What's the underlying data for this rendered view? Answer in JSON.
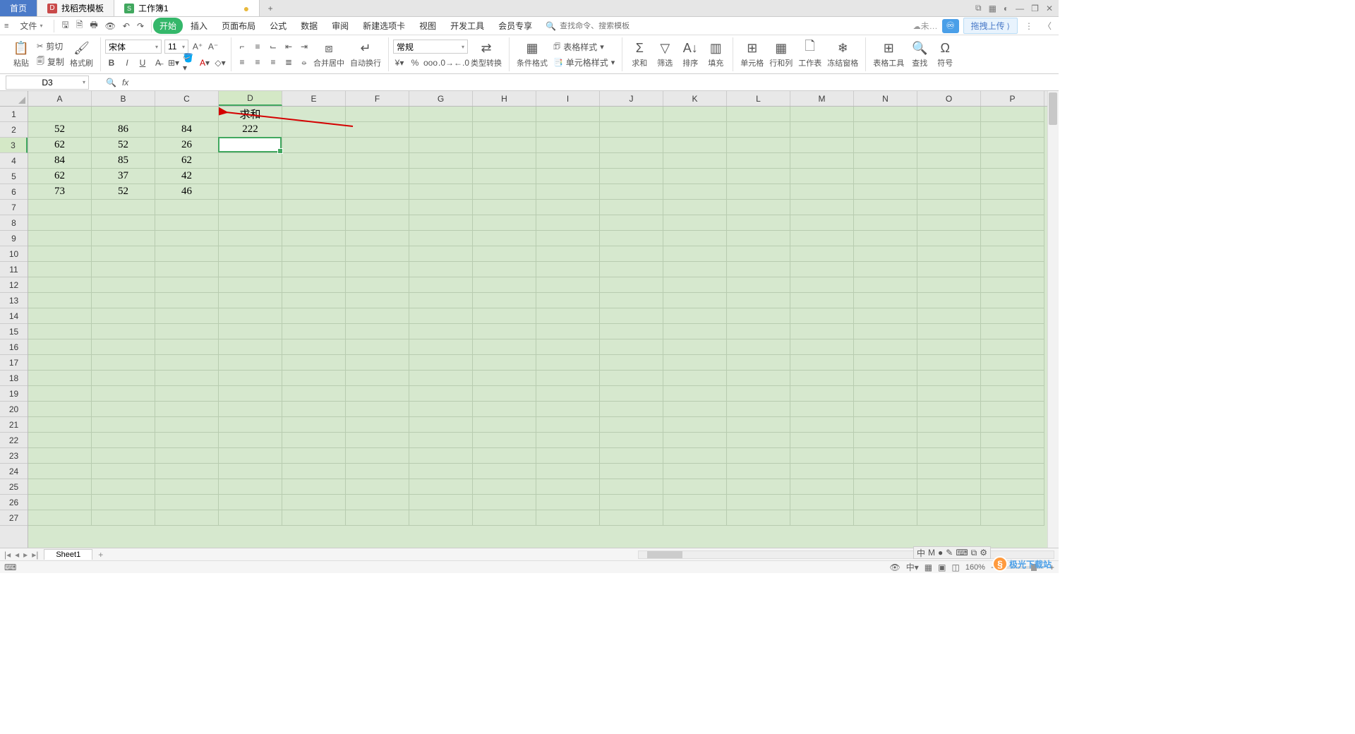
{
  "title_tabs": {
    "home": "首页",
    "template_icon": "D",
    "template": "找稻壳模板",
    "wb_icon": "S",
    "workbook": "工作簿1",
    "dirty": "●",
    "add": "+"
  },
  "win_controls": {
    "layout1": "⧉",
    "grid": "▦",
    "user": "◐",
    "min": "—",
    "max": "❐",
    "close": "✕"
  },
  "menu": {
    "file": "文件",
    "tabs": [
      "开始",
      "插入",
      "页面布局",
      "公式",
      "数据",
      "审阅",
      "新建选项卡",
      "视图",
      "开发工具",
      "会员专享"
    ],
    "search_placeholder": "查找命令、搜索模板",
    "cloud_unsynced": "未…",
    "drag_upload": "拖拽上传"
  },
  "ribbon": {
    "paste": "粘贴",
    "cut": "剪切",
    "copy": "复制",
    "fmt_painter": "格式刷",
    "font_name": "宋体",
    "font_size": "11",
    "merge_center": "合并居中",
    "wrap": "自动换行",
    "number_fmt": "常规",
    "type_conv": "类型转换",
    "cond_fmt": "条件格式",
    "tbl_style": "表格样式",
    "cell_style": "单元格样式",
    "sum": "求和",
    "filter": "筛选",
    "sort": "排序",
    "fill": "填充",
    "cells": "单元格",
    "rowcol": "行和列",
    "worksheet": "工作表",
    "freeze": "冻结窗格",
    "tbl_tools": "表格工具",
    "find": "查找",
    "symbol": "符号"
  },
  "name_box": "D3",
  "formula": "",
  "columns": [
    "A",
    "B",
    "C",
    "D",
    "E",
    "F",
    "G",
    "H",
    "I",
    "J",
    "K",
    "L",
    "M",
    "N",
    "O",
    "P"
  ],
  "rows_count": 27,
  "selected_col": "D",
  "selected_row": 3,
  "cell_data": {
    "D1": {
      "v": "求和",
      "hdr": true
    },
    "A2": {
      "v": "52"
    },
    "B2": {
      "v": "86"
    },
    "C2": {
      "v": "84"
    },
    "D2": {
      "v": "222"
    },
    "A3": {
      "v": "62"
    },
    "B3": {
      "v": "52"
    },
    "C3": {
      "v": "26"
    },
    "A4": {
      "v": "84"
    },
    "B4": {
      "v": "85"
    },
    "C4": {
      "v": "62"
    },
    "A5": {
      "v": "62"
    },
    "B5": {
      "v": "37"
    },
    "C5": {
      "v": "42"
    },
    "A6": {
      "v": "73"
    },
    "B6": {
      "v": "52"
    },
    "C6": {
      "v": "46"
    }
  },
  "active_cell": "D3",
  "sheet_name": "Sheet1",
  "zoom": "160%",
  "watermark": "极光下载站",
  "ime": [
    "中",
    "M",
    "●",
    "✎",
    "⌨",
    "⧉",
    "⚙"
  ]
}
